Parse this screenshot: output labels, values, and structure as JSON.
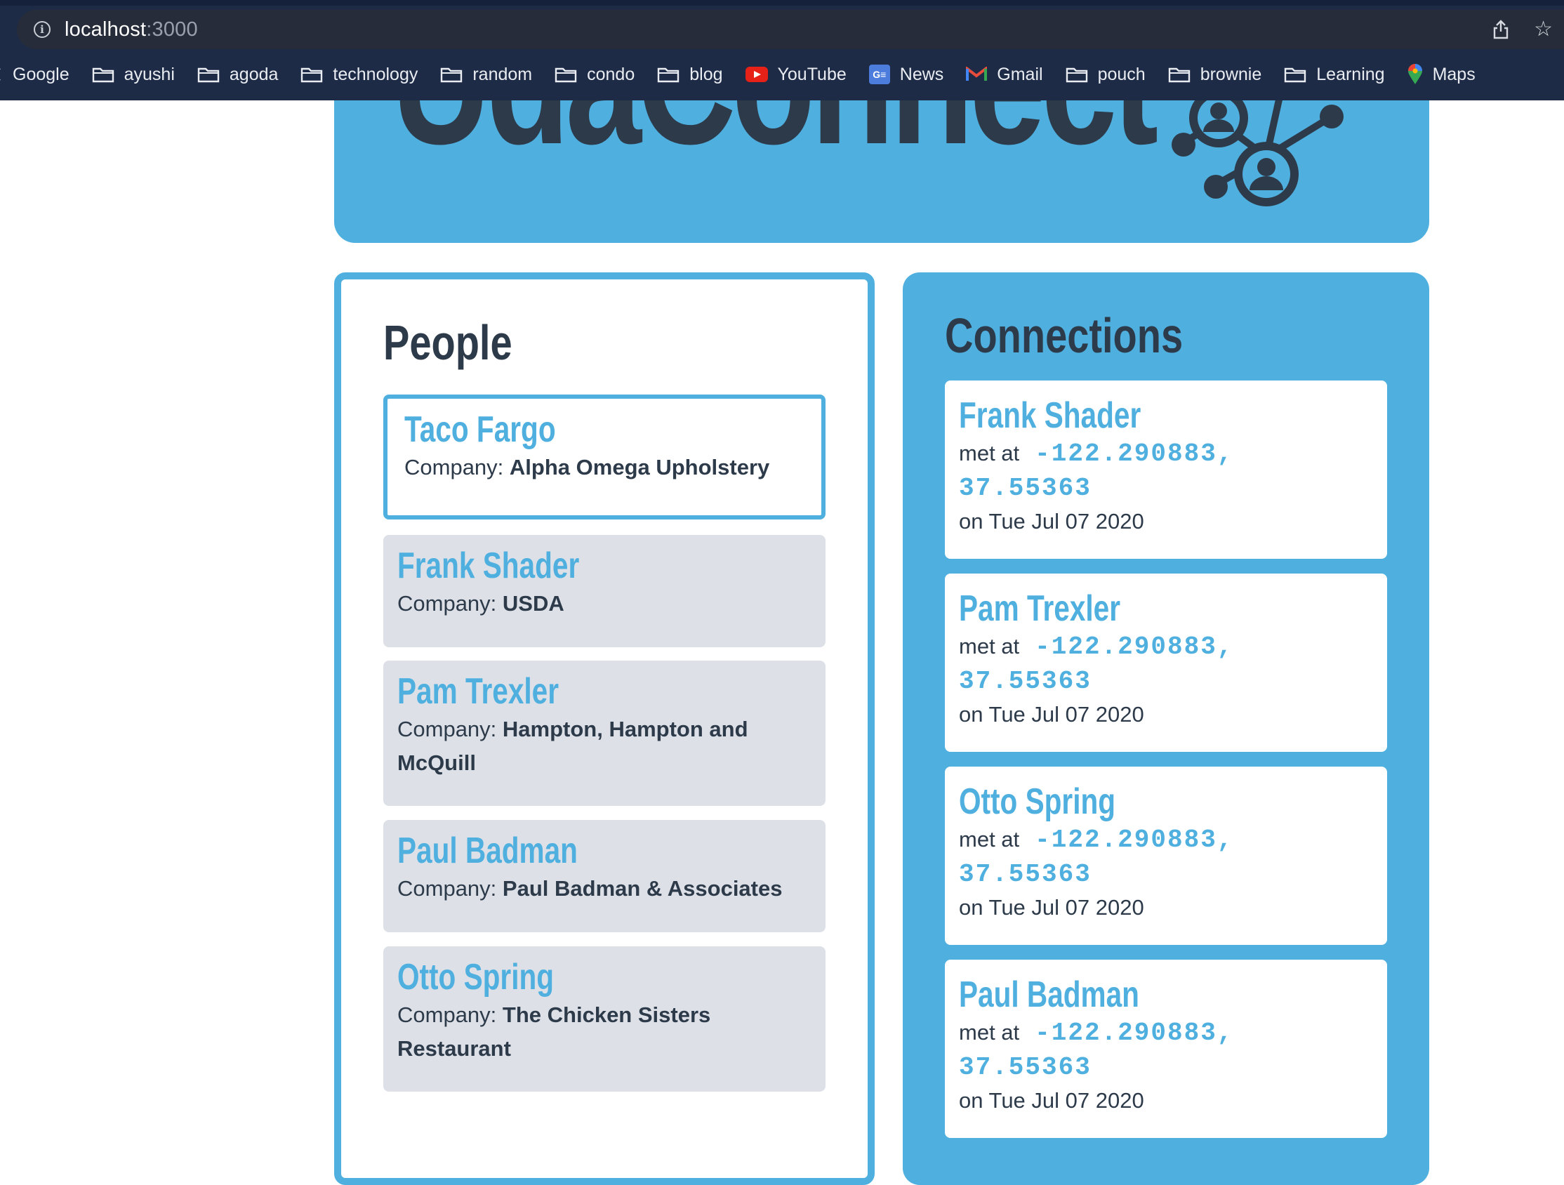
{
  "browser": {
    "url_host": "localhost",
    "url_port": ":3000",
    "bookmarks": [
      {
        "label": "Google",
        "icon": "google-icon"
      },
      {
        "label": "ayushi",
        "icon": "folder-icon"
      },
      {
        "label": "agoda",
        "icon": "folder-icon"
      },
      {
        "label": "technology",
        "icon": "folder-icon"
      },
      {
        "label": "random",
        "icon": "folder-icon"
      },
      {
        "label": "condo",
        "icon": "folder-icon"
      },
      {
        "label": "blog",
        "icon": "folder-icon"
      },
      {
        "label": "YouTube",
        "icon": "youtube-icon"
      },
      {
        "label": "News",
        "icon": "google-news-icon"
      },
      {
        "label": "Gmail",
        "icon": "gmail-icon"
      },
      {
        "label": "pouch",
        "icon": "folder-icon"
      },
      {
        "label": "brownie",
        "icon": "folder-icon"
      },
      {
        "label": "Learning",
        "icon": "folder-icon"
      },
      {
        "label": "Maps",
        "icon": "google-maps-icon"
      }
    ]
  },
  "hero": {
    "title": "UdaConnect"
  },
  "people": {
    "heading": "People",
    "company_label": "Company:",
    "items": [
      {
        "name": "Taco Fargo",
        "company": "Alpha Omega Upholstery"
      },
      {
        "name": "Frank Shader",
        "company": "USDA"
      },
      {
        "name": "Pam Trexler",
        "company": "Hampton, Hampton and McQuill"
      },
      {
        "name": "Paul Badman",
        "company": "Paul Badman & Associates"
      },
      {
        "name": "Otto Spring",
        "company": "The Chicken Sisters Restaurant"
      }
    ]
  },
  "connections": {
    "heading": "Connections",
    "met_at_label": "met at",
    "items": [
      {
        "name": "Frank Shader",
        "longitude": "-122.290883,",
        "latitude": "37.55363",
        "date": "on Tue Jul 07 2020"
      },
      {
        "name": "Pam Trexler",
        "longitude": "-122.290883,",
        "latitude": "37.55363",
        "date": "on Tue Jul 07 2020"
      },
      {
        "name": "Otto Spring",
        "longitude": "-122.290883,",
        "latitude": "37.55363",
        "date": "on Tue Jul 07 2020"
      },
      {
        "name": "Paul Badman",
        "longitude": "-122.290883,",
        "latitude": "37.55363",
        "date": "on Tue Jul 07 2020"
      }
    ]
  },
  "colors": {
    "accent": "#4fb0e0",
    "text": "#2d3a4a",
    "card_gray": "#dde1e7",
    "chrome": "#1e2b46"
  }
}
